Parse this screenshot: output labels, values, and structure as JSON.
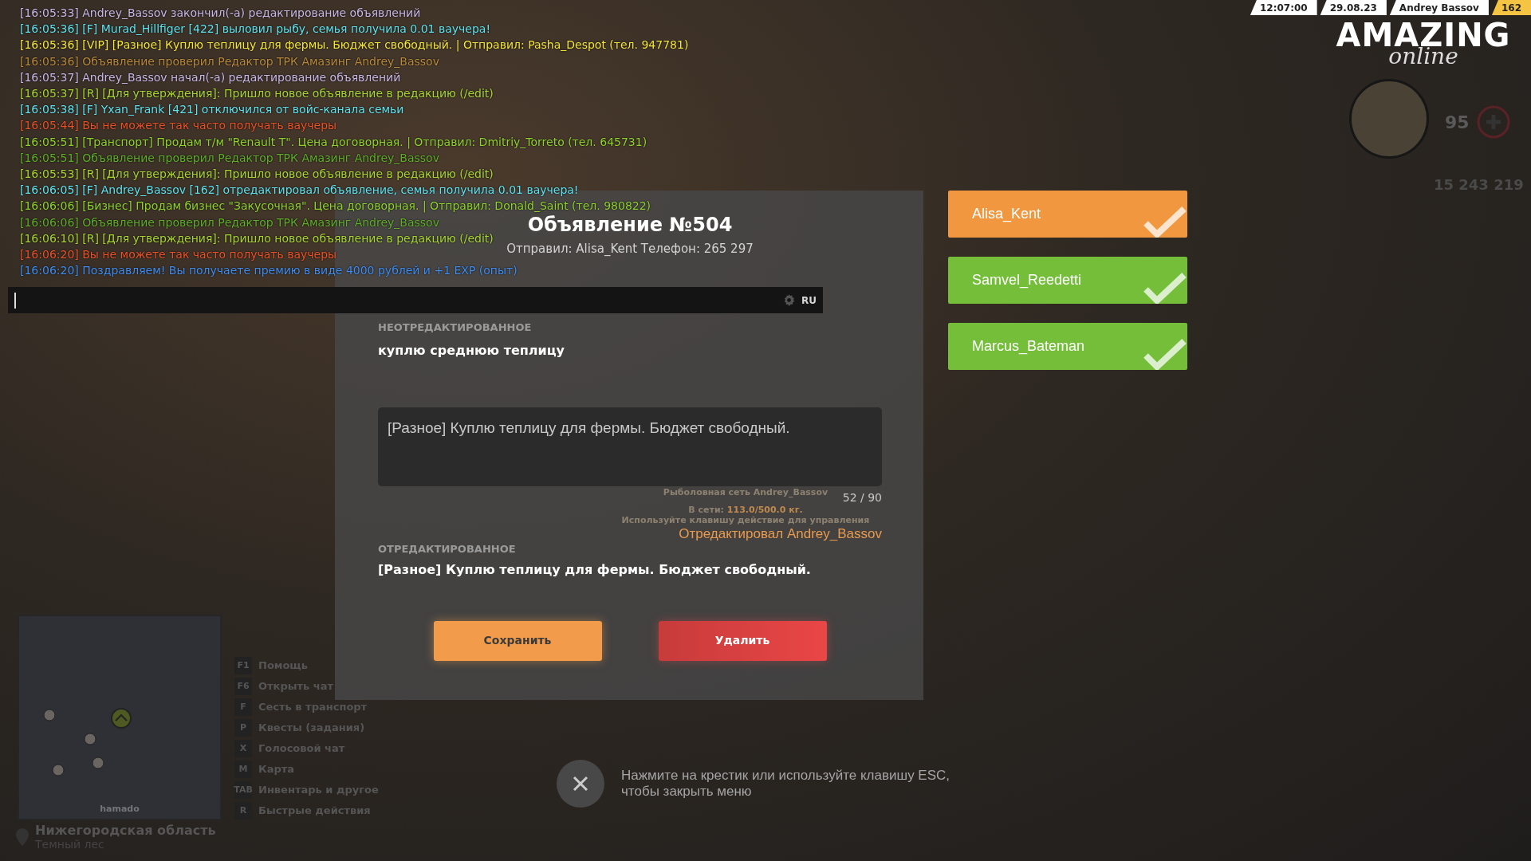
{
  "hud": {
    "time": "12:07:00",
    "date": "29.08.23",
    "player": "Andrey Bassov",
    "level": "162",
    "logo_word": "AMAZING",
    "logo_sub": "online",
    "health": "95",
    "money": "15 243 219"
  },
  "chat": {
    "lines": [
      {
        "text": "[16:05:33] Andrey_Bassov закончил(-а) редактирование объявлений",
        "color": "#c9b8e8"
      },
      {
        "text": "[16:05:36] [F] Murad_Hillfiger [422] выловил рыбу, семья получила 0.01 ваучера!",
        "color": "#5fe3f0"
      },
      {
        "text": "[16:05:36] [VIP] [Разное] Куплю теплицу для фермы. Бюджет свободный. | Отправил: Pasha_Despot (тел. 947781)",
        "color": "#f5e63a"
      },
      {
        "text": "[16:05:36] Объявление проверил Редактор ТРК Амазинг Andrey_Bassov",
        "color": "#b98a3c"
      },
      {
        "text": "[16:05:37] Andrey_Bassov начал(-а) редактирование объявлений",
        "color": "#c9b8e8"
      },
      {
        "text": "[16:05:37] [R] [Для утверждения]: Пришло новое объявление в редакцию (/edit)",
        "color": "#a8d632"
      },
      {
        "text": "[16:05:38] [F] Yxan_Frank [421] отключился от войс-канала семьи",
        "color": "#5fe3f0"
      },
      {
        "text": "[16:05:44] Вы не можете так часто получать ваучеры",
        "color": "#ec5228"
      },
      {
        "text": "[16:05:51] [Транспорт] Продам т/м \"Renault T\". Цена договорная. | Отправил: Dmitriy_Torreto (тел. 645731)",
        "color": "#8fd42e"
      },
      {
        "text": "[16:05:51] Объявление проверил Редактор ТРК Амазинг Andrey_Bassov",
        "color": "#5fae2a"
      },
      {
        "text": "[16:05:53] [R] [Для утверждения]: Пришло новое объявление в редакцию (/edit)",
        "color": "#a8d632"
      },
      {
        "text": "[16:06:05] [F] Andrey_Bassov [162] отредактировал объявление, семья получила 0.01 ваучера!",
        "color": "#5fe3f0"
      },
      {
        "text": "[16:06:06] [Бизнес] Продам бизнес \"Закусочная\". Цена договорная. | Отправил: Donald_Saint (тел. 980822)",
        "color": "#8fd42e"
      },
      {
        "text": "[16:06:06] Объявление проверил Редактор ТРК Амазинг Andrey_Bassov",
        "color": "#5fae2a"
      },
      {
        "text": "[16:06:10] [R] [Для утверждения]: Пришло новое объявление в редакцию (/edit)",
        "color": "#a8d632"
      },
      {
        "text": "[16:06:20] Вы не можете так часто получать ваучеры",
        "color": "#ec5228"
      },
      {
        "text": "[16:06:20] Поздравляем! Вы получаете премию в виде 4000 рублей и +1 EXP (опыт)",
        "color": "#3f8ef2"
      }
    ],
    "language": "RU"
  },
  "ad": {
    "title": "Объявление №504",
    "sender": "Отправил: Alisa_Kent Телефон: 265 297",
    "original_label": "НЕОТРЕДАКТИРОВАННОЕ",
    "original_text": "куплю среднюю теплицу",
    "edit_value": "[Разное] Куплю теплицу для фермы. Бюджет свободный.",
    "counter": "52 / 90",
    "editor_note": "Отредактировал Andrey_Bassov",
    "edited_label": "ОТРЕДАКТИРОВАННОЕ",
    "edited_text": "[Разное] Куплю теплицу для фермы. Бюджет свободный.",
    "buttons": [
      {
        "label": "Сохранить",
        "kind": "save"
      },
      {
        "label": "Удалить",
        "kind": "delete"
      }
    ]
  },
  "world_text": {
    "net_name": "Рыболовная сеть Andrey_Bassov",
    "net_label": "В сети:",
    "net_value": "113.0/500.0 кг.",
    "hint": "Используйте клавишу действие для управления"
  },
  "editors": [
    {
      "name": "Alisa_Kent",
      "color": "#f0973f"
    },
    {
      "name": "Samvel_Reedetti",
      "color": "#75be3a"
    },
    {
      "name": "Marcus_Bateman",
      "color": "#75be3a"
    }
  ],
  "minimap": {
    "label": "hamado"
  },
  "hotkeys": [
    {
      "key": "F1",
      "label": "Помощь"
    },
    {
      "key": "F6",
      "label": "Открыть чат"
    },
    {
      "key": "F",
      "label": "Сесть в транспорт"
    },
    {
      "key": "P",
      "label": "Квесты (задания)"
    },
    {
      "key": "X",
      "label": "Голосовой чат"
    },
    {
      "key": "M",
      "label": "Карта"
    },
    {
      "key": "TAB",
      "label": "Инвентарь и другое"
    },
    {
      "key": "R",
      "label": "Быстрые действия"
    }
  ],
  "location": {
    "region": "Нижегородская область",
    "area": "Темный лес"
  },
  "close_hint": "Нажмите на крестик или используйте клавишу ESC, чтобы закрыть меню"
}
